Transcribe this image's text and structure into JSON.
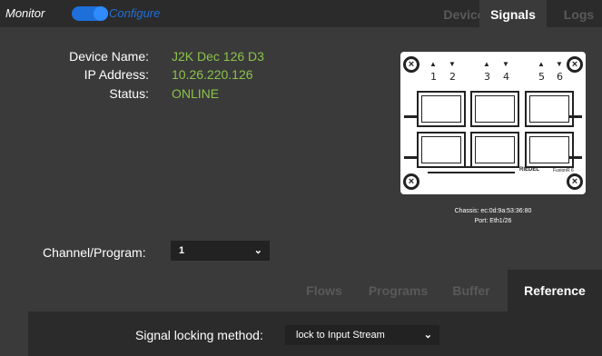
{
  "mode": {
    "monitor": "Monitor",
    "configure": "Configure"
  },
  "top_tabs": [
    {
      "label": "Device",
      "active": false
    },
    {
      "label": "Signals",
      "active": true
    },
    {
      "label": "Logs",
      "active": false
    }
  ],
  "device_info": {
    "name_label": "Device Name:",
    "name_value": "J2K Dec 126 D3",
    "ip_label": "IP Address:",
    "ip_value": "10.26.220.126",
    "status_label": "Status:",
    "status_value": "ONLINE"
  },
  "device_graphic": {
    "ports": [
      "1",
      "2",
      "3",
      "4",
      "5",
      "6"
    ],
    "brand": "RIEDEL",
    "model": "FusionR 6",
    "chassis": "Chassis: ec:0d:9a:53:36:80",
    "port": "Port: Eth1/26"
  },
  "channel": {
    "label": "Channel/Program:",
    "value": "1"
  },
  "sub_tabs": [
    {
      "label": "Flows",
      "active": false
    },
    {
      "label": "Programs",
      "active": false
    },
    {
      "label": "Buffer",
      "active": false
    },
    {
      "label": "Reference",
      "active": true
    }
  ],
  "reference": {
    "lock_label": "Signal locking method:",
    "lock_value": "lock to Input Stream"
  },
  "colors": {
    "background": "#3a3a3a",
    "topbar": "#2b2b2b",
    "accent_blue": "#1e6fd9",
    "value_green": "#8bc34a"
  }
}
